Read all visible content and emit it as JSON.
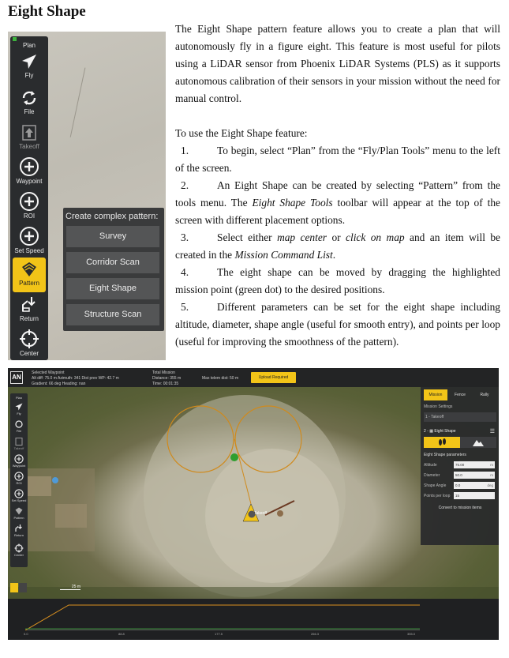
{
  "doc_title": "Eight Shape",
  "intro": "The Eight Shape pattern feature allows you to create a plan that will autonomously fly in a figure eight. This feature is most useful for pilots using a LiDAR sensor from Phoenix LiDAR Systems (PLS) as it supports autonomous calibration of their sensors in your mission without the need for manual control.",
  "howto": "To use the Eight Shape feature:",
  "steps": [
    {
      "num": "1.",
      "text": "To begin, select “Plan” from the “Fly/Plan Tools” menu to the left of the screen."
    },
    {
      "num": "2.",
      "text_a": "An Eight Shape can be created by selecting “Pattern” from the tools menu. The ",
      "em": "Eight Shape Tools",
      "text_b": " toolbar will appear at the top of the screen with different placement options."
    },
    {
      "num": "3.",
      "text_a": "Select either ",
      "em_a": "map center",
      "mid": " or ",
      "em_b": "click on map",
      "text_b": " and an item will be created in the ",
      "em_c": "Mission Command List",
      "end": "."
    },
    {
      "num": "4.",
      "text": "The eight shape can be moved by dragging the highlighted mission point (green dot) to the desired positions."
    },
    {
      "num": "5.",
      "text": "Different parameters can be set for the eight shape including altitude, diameter, shape angle (useful for smooth entry), and points per loop (useful for improving the smoothness of the pattern)."
    }
  ],
  "toolbar": {
    "plan": "Plan",
    "fly": "Fly",
    "file": "File",
    "takeoff": "Takeoff",
    "waypoint": "Waypoint",
    "roi": "ROI",
    "set_speed": "Set Speed",
    "pattern": "Pattern",
    "return": "Return",
    "center": "Center"
  },
  "pattern_popup": {
    "title": "Create complex pattern:",
    "items": [
      "Survey",
      "Corridor Scan",
      "Eight Shape",
      "Structure Scan"
    ]
  },
  "qgc": {
    "logo": "AN",
    "selected_waypoint": {
      "title": "Selected Waypoint",
      "line1": "Alt diff:      75.0 m     Azimuth:   341     Dist prev WP:  42.7 m",
      "line2": "Gradient:  66 deg    Heading:  nan"
    },
    "total_mission": {
      "title": "Total Mission",
      "line1": "Distance:    355 m",
      "line2": "Time:           00:01:35"
    },
    "max_telem": "Max telem dist:  50 m",
    "upload_label": "Upload Required",
    "tabs": [
      "Mission",
      "Fence",
      "Rally"
    ],
    "mission_settings": "Mission Settings",
    "takeoff_item": "1 - Takeoff",
    "eight_item": "2 - ▦ Eight Shape",
    "eight_params": "Eight Shape parameters",
    "params": [
      {
        "label": "Altitude",
        "value": "75.00",
        "unit": "m"
      },
      {
        "label": "Diameter",
        "value": "50.0",
        "unit": "m"
      },
      {
        "label": "Shape Angle",
        "value": "0.0",
        "unit": "deg"
      },
      {
        "label": "Points per loop",
        "value": "15",
        "unit": ""
      }
    ],
    "convert": "Convert to mission items",
    "map_takeoff_label": "Takeoff",
    "scale": "25 m",
    "toolbar": [
      "Plan",
      "Fly",
      "File",
      "Takeoff",
      "Waypoint",
      "ROI",
      "Set Speed",
      "Pattern",
      "Return",
      "Center"
    ],
    "elev_ticks": [
      "0.0",
      "88.8",
      "177.5",
      "266.3",
      "355.0"
    ]
  }
}
